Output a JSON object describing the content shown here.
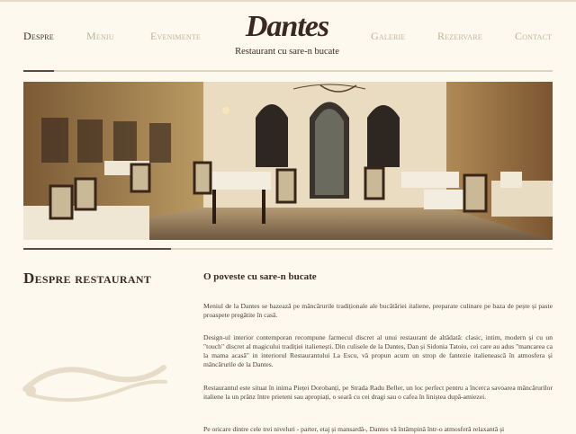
{
  "nav": {
    "despre": "Despre",
    "meniu": "Meniu",
    "evenimente": "Evenimente",
    "galerie": "Galerie",
    "rezervare": "Rezervare",
    "contact": "Contact"
  },
  "logo": {
    "name": "Dantes",
    "tagline": "Restaurant cu sare-n bucate"
  },
  "about": {
    "title": "Despre restaurant",
    "subtitle": "O poveste cu sare-n bucate",
    "paragraphs": [
      "Meniul de la Dantes se bazează pe mâncărurile tradiționale ale bucătăriei italiene, preparate culinare pe baza de pește și paste proaspete pregătite în casă.",
      "Design-ul interior contemporan recompune farmecul discret al unui restaurant de altădată: clasic, intim, modern și cu un \"touch\" discret al magicului tradiției italienești. Din culisele de la Dantes, Dan și Sidonia Tatoiu, cei care au adus \"mancarea ca la mama acasă\" in interiorul Restaurantului La Escu, vă propun acum un strop de fantezie italienească în atmosfera și mâncărurile de la Dantes.",
      "Restaurantul este situat în inima Pieței Dorobanți, pe Strada Radu Beller, un loc perfect pentru a încerca savoarea mâncărurilor italiene la un prânz între prieteni sau apropiați, o seară cu cei dragi sau o cafea în liniștea după-amiezei.",
      "Pe oricare dintre cele trei niveluri - parter, etaj și mansardă-, Dantes vă întâmpină într-o atmosferă relaxantă și"
    ]
  },
  "colors": {
    "background": "#fdf9ee",
    "text": "#3e2a22",
    "nav_inactive": "#bfb29a",
    "accent_rule": "#5a4a44"
  }
}
